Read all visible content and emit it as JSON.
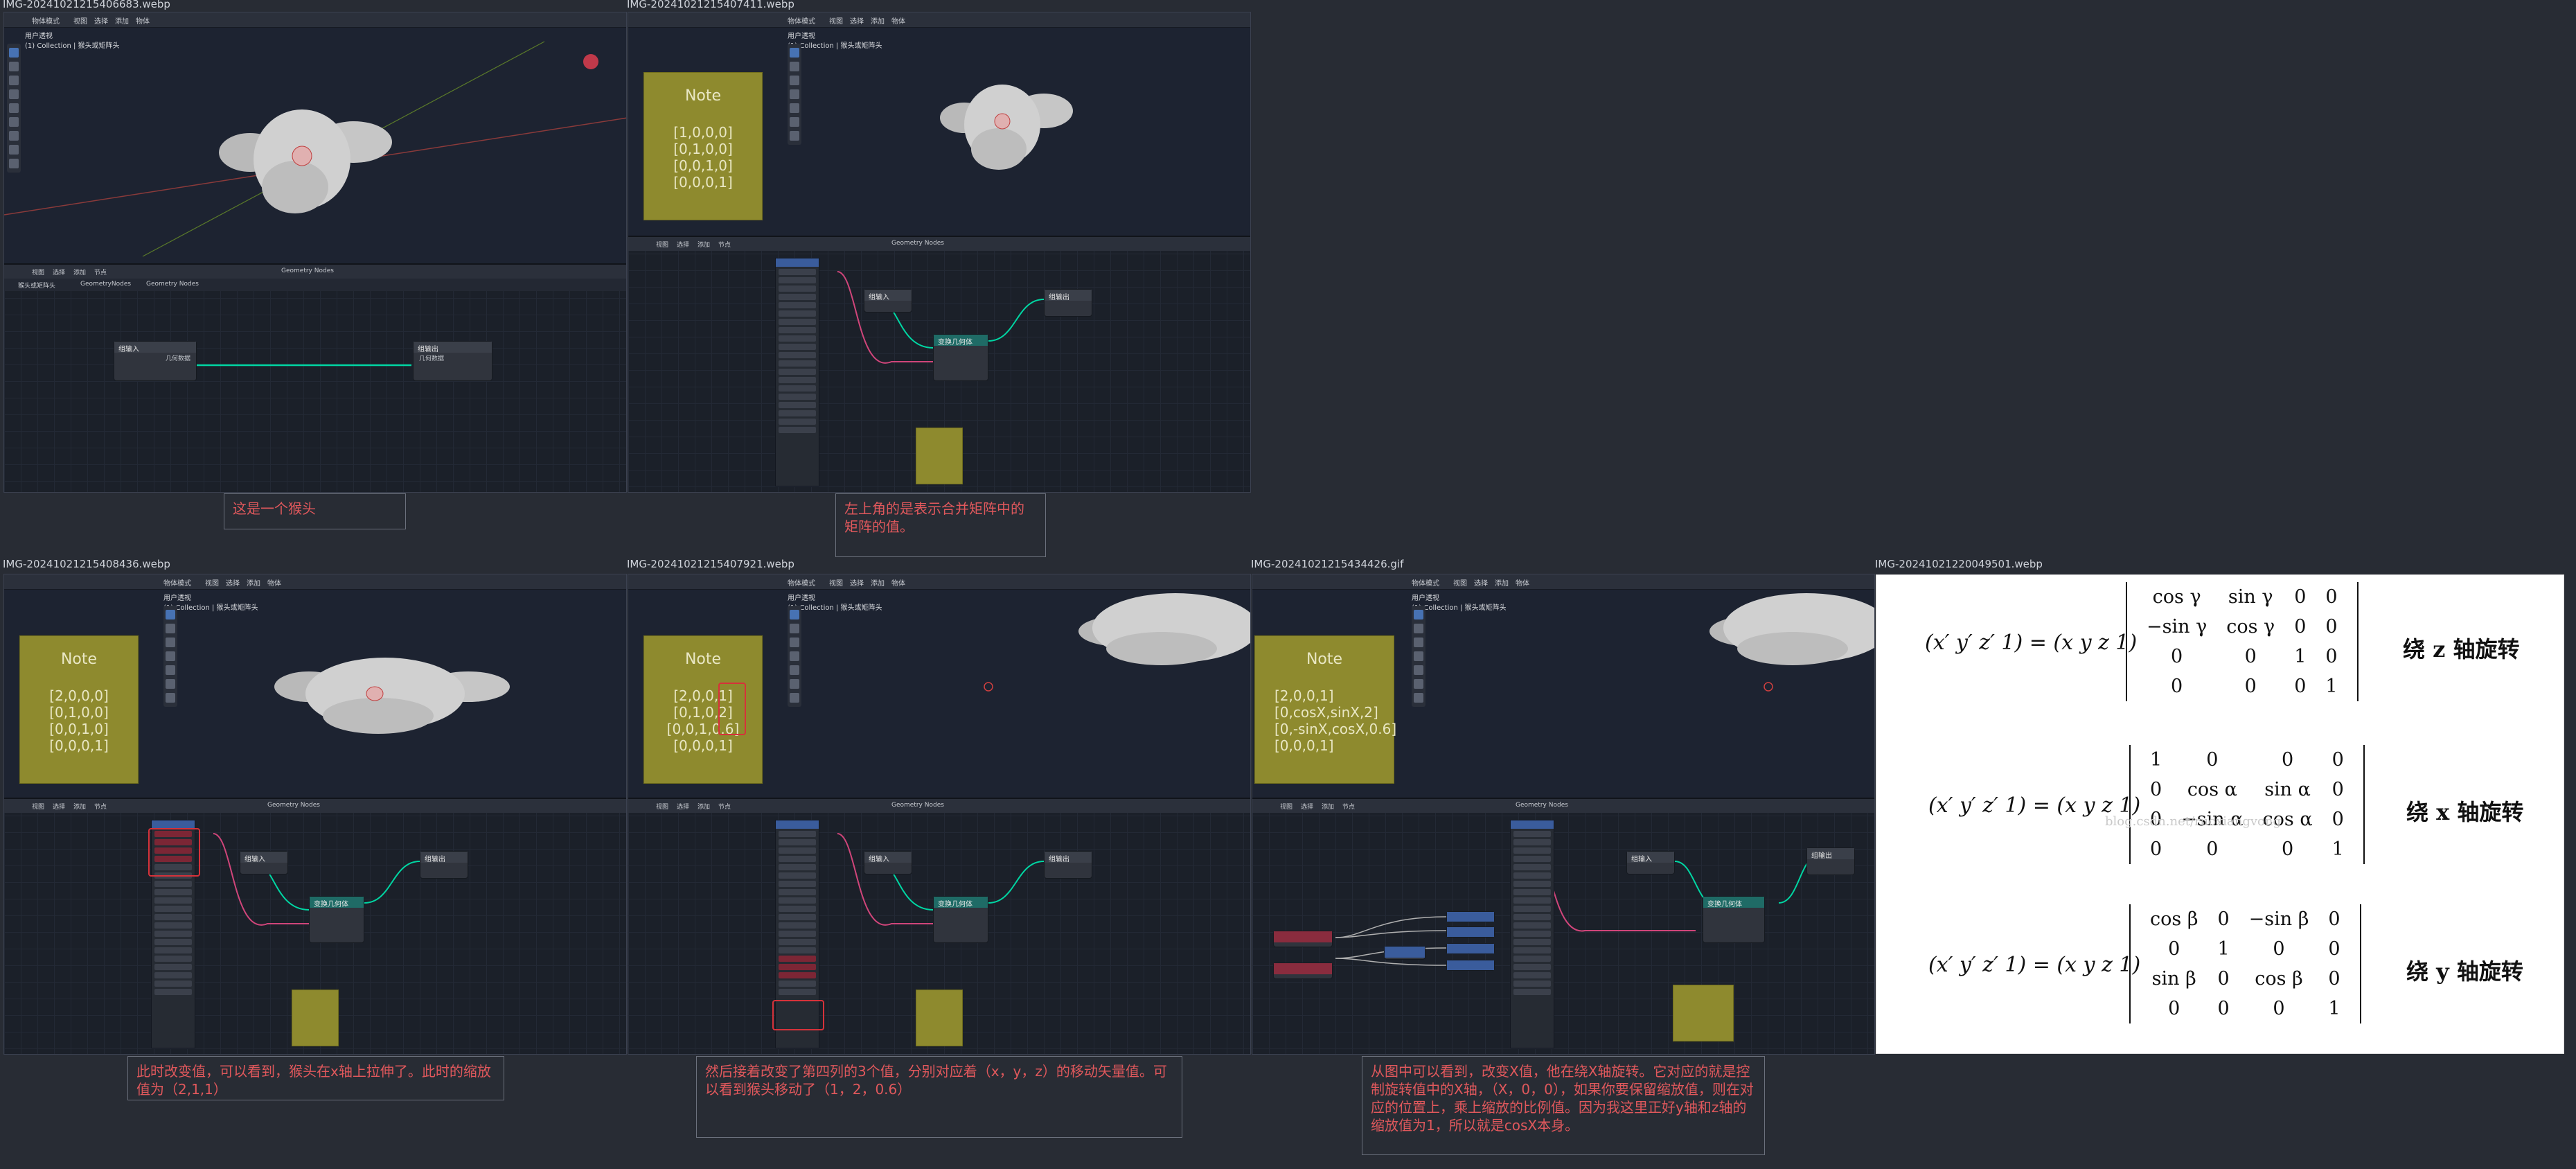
{
  "captions": [
    "IMG-20241021215406683.webp",
    "IMG-20241021215407411.webp",
    "IMG-20241021215408436.webp",
    "IMG-20241021215407921.webp",
    "IMG-20241021215434426.gif",
    "IMG-20241021220049501.webp"
  ],
  "viewport": {
    "collection_label": "用户透视",
    "collection_sub": "(1) Collection | 猴头或矩阵头",
    "menu": [
      "视图",
      "选择",
      "添加",
      "物体"
    ],
    "mode": "物体模式"
  },
  "node_editor": {
    "menu": [
      "视图",
      "选择",
      "添加",
      "节点"
    ],
    "breadcrumb": [
      "猴头或矩阵头",
      "GeometryNodes",
      "Geometry Nodes"
    ],
    "tree_name": "Geometry Nodes",
    "group_input": "组输入",
    "group_output": "组输出",
    "geometry_socket": "几何数据",
    "transform_node": "变换几何体",
    "combine_matrix": "合并矩阵"
  },
  "notes": {
    "title": "Note",
    "shot2": [
      "[1,0,0,0]",
      "[0,1,0,0]",
      "[0,0,1,0]",
      "[0,0,0,1]"
    ],
    "shot3": [
      "[2,0,0,0]",
      "[0,1,0,0]",
      "[0,0,1,0]",
      "[0,0,0,1]"
    ],
    "shot4": [
      "[2,0,0,1]",
      "[0,1,0,2]",
      "[0,0,1,0.6]",
      "[0,0,0,1]"
    ],
    "shot5": [
      "[2,0,0,1]",
      "[0,cosX,sinX,2]",
      "[0,-sinX,cosX,0.6]",
      "[0,0,0,1]"
    ]
  },
  "callouts": {
    "c1": "这是一个猴头",
    "c2": "左上角的是表示合并矩阵中的矩阵的值。",
    "c3": "此时改变值，可以看到，猴头在x轴上拉伸了。此时的缩放值为（2,1,1）",
    "c4": "然后接着改变了第四列的3个值，分别对应着（x，y，z）的移动矢量值。可以看到猴头移动了（1，2，0.6）",
    "c5": "从图中可以看到，改变X值，他在绕X轴旋转。它对应的就是控制旋转值中的X轴，（X，0，0），如果你要保留缩放值，则在对应的位置上，乘上缩放的比例值。因为我这里正好y轴和z轴的缩放值为1，所以就是cosX本身。"
  },
  "math": {
    "lhs": "(x′ y′ z′ 1) = (x y z 1)",
    "watermark": "blog.csdn.net/ruoxiangvong",
    "z": {
      "label": "绕 z 轴旋转",
      "rows": [
        [
          "cos γ",
          "sin γ",
          "0",
          "0"
        ],
        [
          "−sin γ",
          "cos γ",
          "0",
          "0"
        ],
        [
          "0",
          "0",
          "1",
          "0"
        ],
        [
          "0",
          "0",
          "0",
          "1"
        ]
      ]
    },
    "x": {
      "label": "绕 x 轴旋转",
      "rows": [
        [
          "1",
          "0",
          "0",
          "0"
        ],
        [
          "0",
          "cos α",
          "sin α",
          "0"
        ],
        [
          "0",
          "−sin α",
          "cos α",
          "0"
        ],
        [
          "0",
          "0",
          "0",
          "1"
        ]
      ]
    },
    "y": {
      "label": "绕 y 轴旋转",
      "rows": [
        [
          "cos β",
          "0",
          "−sin β",
          "0"
        ],
        [
          "0",
          "1",
          "0",
          "0"
        ],
        [
          "sin β",
          "0",
          "cos β",
          "0"
        ],
        [
          "0",
          "0",
          "0",
          "1"
        ]
      ]
    }
  }
}
